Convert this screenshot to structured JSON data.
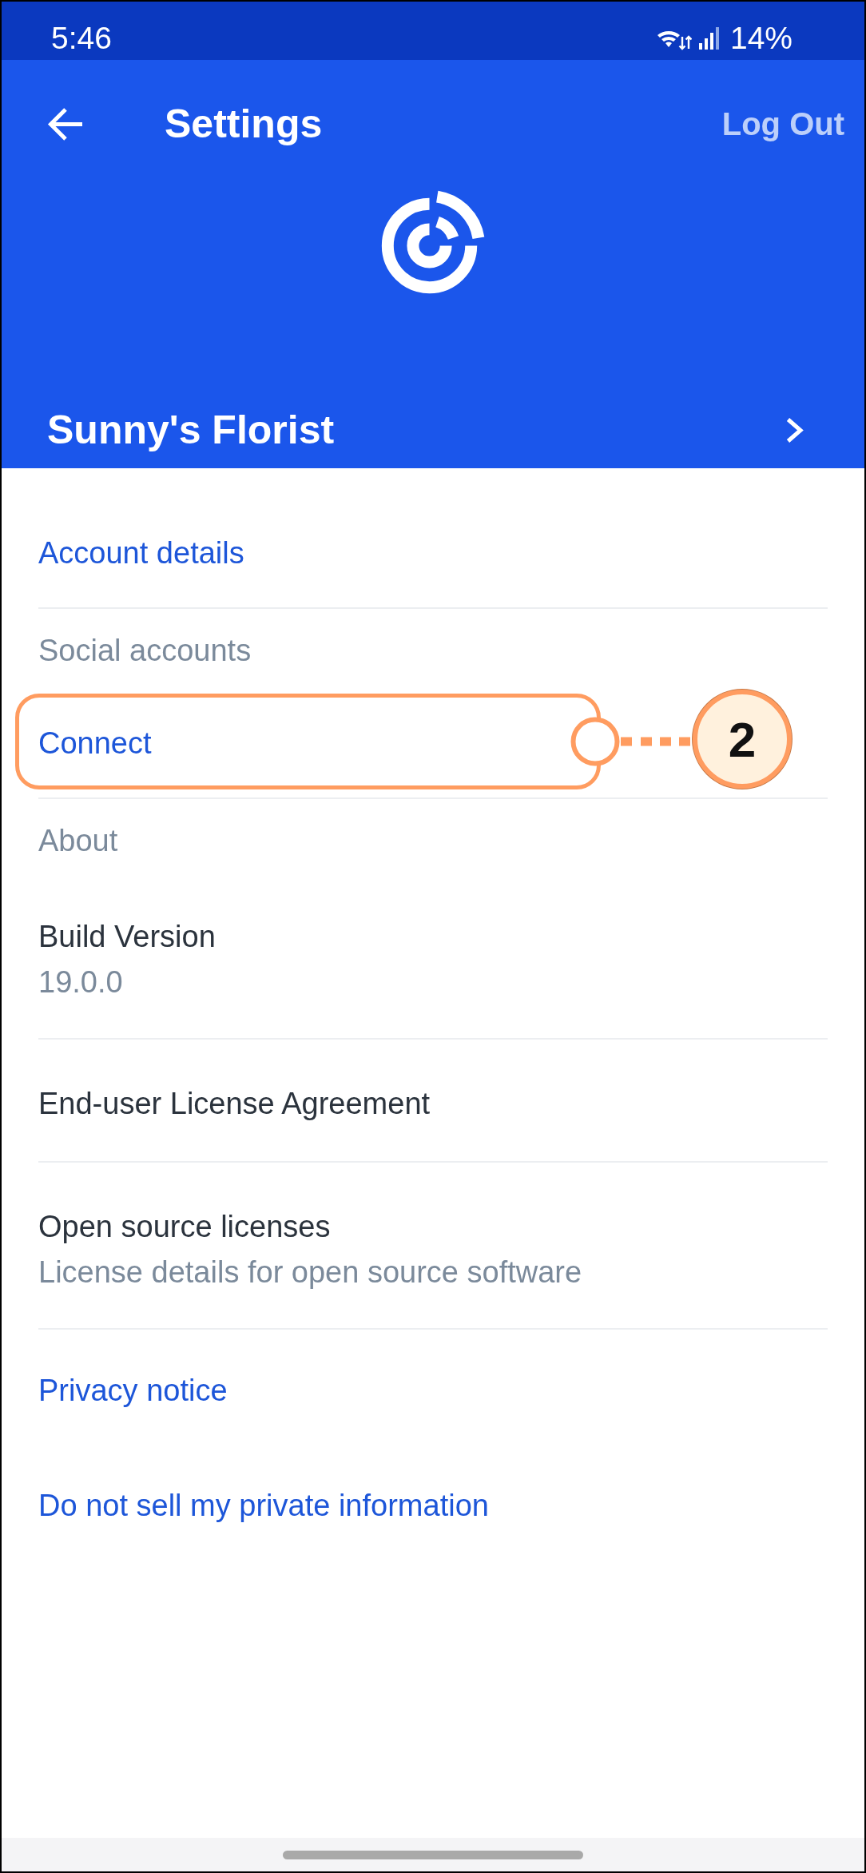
{
  "status_bar": {
    "time": "5:46",
    "battery": "14%"
  },
  "header": {
    "title": "Settings",
    "action": "Log Out",
    "account": "Sunny's Florist"
  },
  "sections": [
    {
      "items": [
        {
          "kind": "link",
          "label": "Account details"
        }
      ]
    },
    {
      "heading": "Social accounts",
      "items": [
        {
          "kind": "link",
          "label": "Connect",
          "callout": "2"
        }
      ]
    },
    {
      "heading": "About",
      "items": [
        {
          "kind": "detail",
          "label": "Build Version",
          "sublabel": "19.0.0"
        }
      ]
    },
    {
      "items": [
        {
          "kind": "detail",
          "label": "End-user License Agreement"
        }
      ]
    },
    {
      "items": [
        {
          "kind": "detail",
          "label": "Open source licenses",
          "sublabel": "License details for open source software"
        }
      ]
    },
    {
      "items": [
        {
          "kind": "link",
          "label": "Privacy notice"
        },
        {
          "kind": "link",
          "label": "Do not sell my private information"
        }
      ]
    }
  ]
}
